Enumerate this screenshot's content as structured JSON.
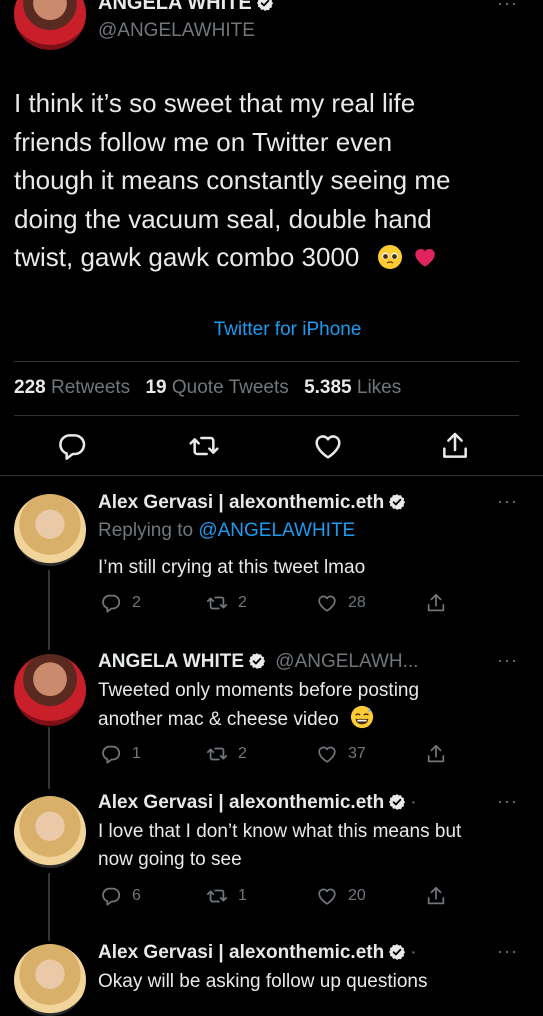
{
  "main_tweet": {
    "author_name": "ANGELA WHITE",
    "author_handle": "@ANGELAWHITE",
    "text_lines": [
      "I think it’s so sweet that my real life",
      "friends follow me on Twitter even",
      "though it means constantly seeing me",
      "doing the vacuum seal, double hand",
      "twist, gawk gawk combo 3000"
    ],
    "source": "Twitter for iPhone",
    "retweets_count": "228",
    "retweets_label": "Retweets",
    "quotes_count": "19",
    "quotes_label": "Quote Tweets",
    "likes_count": "5.385",
    "likes_label": "Likes"
  },
  "replies": [
    {
      "author_name": "Alex Gervasi | alexonthemic.eth",
      "replying_prefix": "Replying to",
      "replying_handle": "@ANGELAWHITE",
      "text_lines": [
        "I’m still crying at this tweet lmao"
      ],
      "replies": "2",
      "retweets": "2",
      "likes": "28"
    },
    {
      "author_name": "ANGELA WHITE",
      "author_handle": "@ANGELAWH...",
      "text_lines": [
        "Tweeted only moments before posting",
        "another mac & cheese video"
      ],
      "replies": "1",
      "retweets": "2",
      "likes": "37"
    },
    {
      "author_name": "Alex Gervasi | alexonthemic.eth",
      "text_lines": [
        "I love that I don’t know what this means but",
        "now going to see"
      ],
      "replies": "6",
      "retweets": "1",
      "likes": "20"
    },
    {
      "author_name": "Alex Gervasi | alexonthemic.eth",
      "text_lines": [
        "Okay will be asking follow up questions"
      ]
    }
  ],
  "icons": {
    "verified": "verified-badge-icon",
    "reply": "reply-icon",
    "retweet": "retweet-icon",
    "like": "heart-icon",
    "share": "share-icon",
    "more": "more-icon"
  },
  "colors": {
    "background": "#000000",
    "text": "#e7e9ea",
    "muted": "#71767b",
    "link": "#1d9bf0",
    "divider": "#2f3336"
  }
}
